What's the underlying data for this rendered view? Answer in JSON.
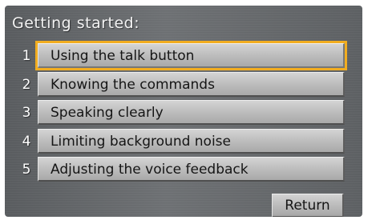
{
  "screen": {
    "title": "Getting started:"
  },
  "menu": {
    "items": [
      {
        "number": "1",
        "label": "Using the talk button"
      },
      {
        "number": "2",
        "label": "Knowing the commands"
      },
      {
        "number": "3",
        "label": "Speaking clearly"
      },
      {
        "number": "4",
        "label": "Limiting background noise"
      },
      {
        "number": "5",
        "label": "Adjusting the voice feedback"
      }
    ],
    "selected_index": 0
  },
  "footer": {
    "return_label": "Return"
  },
  "colors": {
    "highlight": "#f2ad20",
    "button_face": "#bdbdbd",
    "background": "#666a6d"
  }
}
